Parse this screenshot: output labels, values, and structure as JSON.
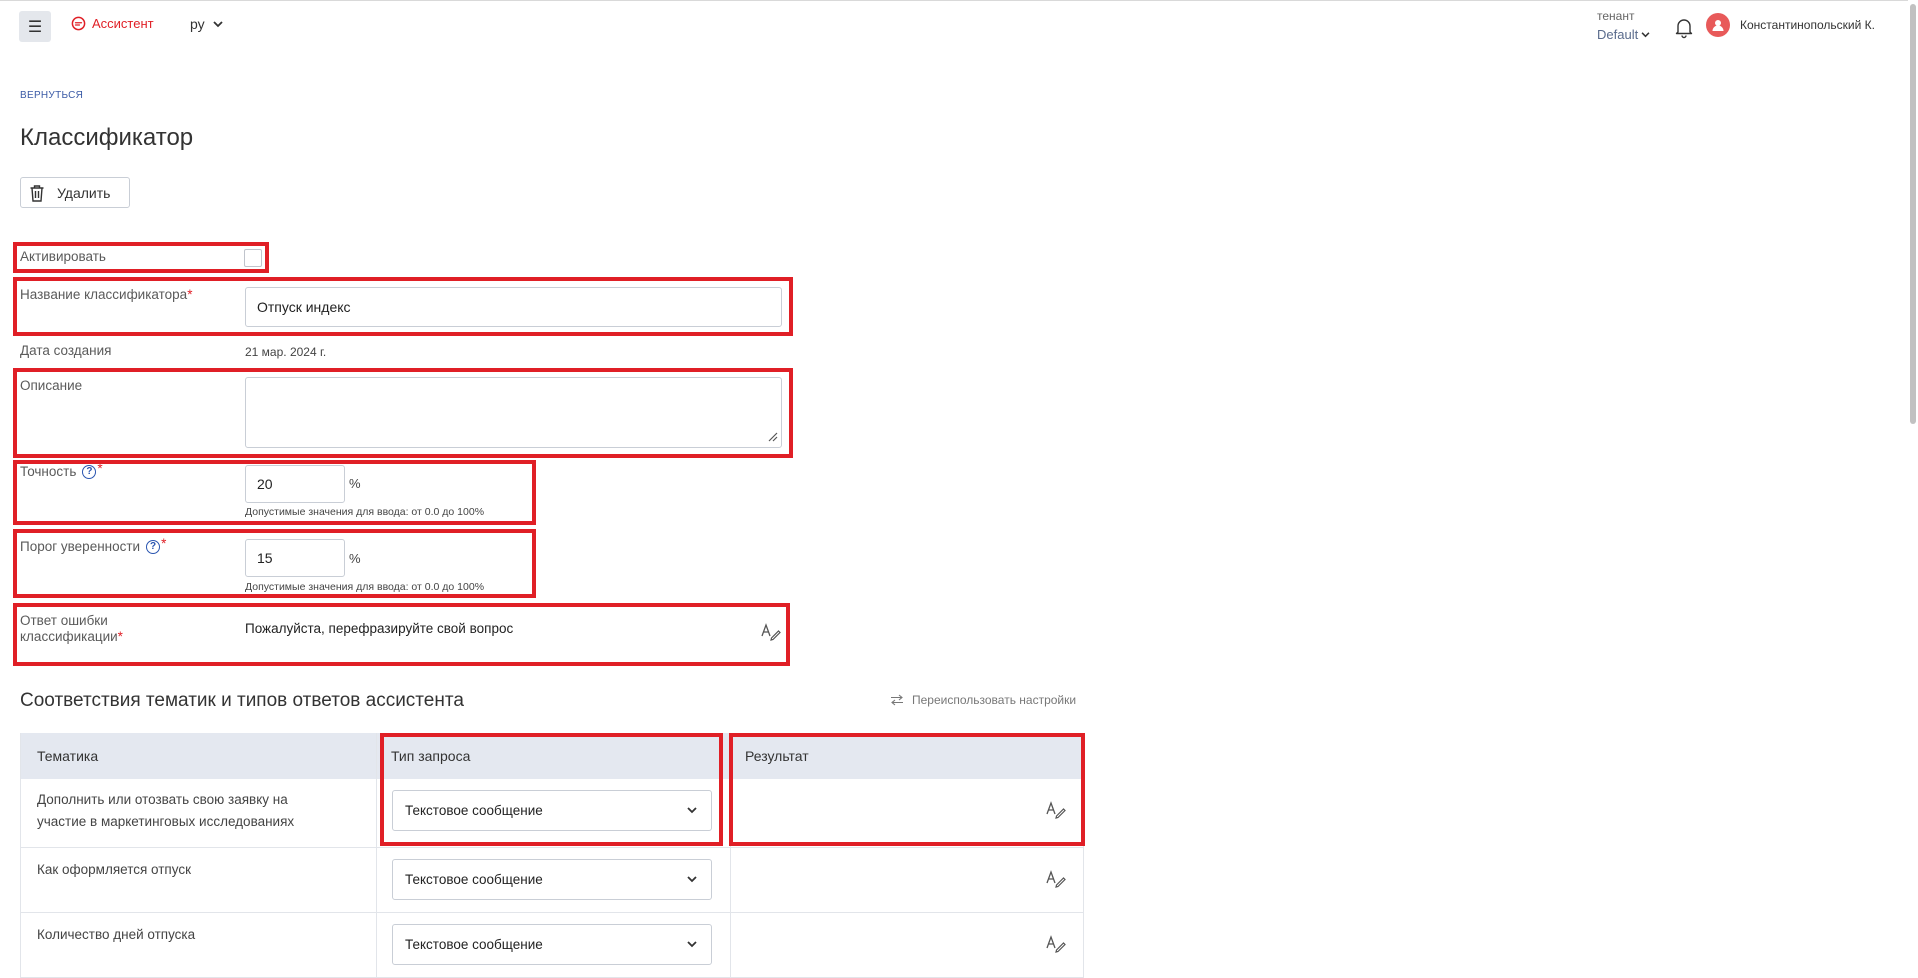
{
  "header": {
    "menu_icon": "hamburger-icon",
    "brand_label": "Ассистент",
    "brand_color": "#e01f26",
    "language": "ру",
    "tenant_label": "тенант",
    "tenant_value": "Default",
    "user_name": "Константинопольский К."
  },
  "page": {
    "back_label": "ВЕРНУТЬСЯ",
    "title": "Классификатор",
    "delete_label": "Удалить"
  },
  "form": {
    "activate_label": "Активировать",
    "activate_checked": false,
    "name_label": "Название классификатора",
    "name_value": "Отпуск индекс",
    "created_label": "Дата создания",
    "created_value": "21 мар. 2024 г.",
    "description_label": "Описание",
    "description_value": "",
    "accuracy_label": "Точность",
    "accuracy_value": "20",
    "accuracy_unit": "%",
    "accuracy_hint": "Допустимые значения для ввода: от 0.0 до 100%",
    "threshold_label": "Порог уверенности",
    "threshold_value": "15",
    "threshold_unit": "%",
    "threshold_hint": "Допустимые значения для ввода: от 0.0 до 100%",
    "error_label_line1": "Ответ ошибки",
    "error_label_line2": "классификации",
    "error_value": "Пожалуйста, перефразируйте свой вопрос",
    "required_mark": "*"
  },
  "mapping": {
    "title": "Соответствия тематик и типов ответов ассистента",
    "reuse_label": "Переиспользовать настройки",
    "columns": [
      "Тематика",
      "Тип запроса",
      "Результат"
    ],
    "rows": [
      {
        "topic": "Дополнить или отозвать свою заявку на участие в маркетинговых исследованиях",
        "type": "Текстовое сообщение",
        "result": ""
      },
      {
        "topic": "Как оформляется отпуск",
        "type": "Текстовое сообщение",
        "result": ""
      },
      {
        "topic": "Количество дней отпуска",
        "type": "Текстовое сообщение",
        "result": ""
      }
    ]
  },
  "colors": {
    "highlight": "#e01f26",
    "header_row": "#e4e8f0",
    "link": "#3a5aa6",
    "help_icon": "#2a55b0"
  }
}
